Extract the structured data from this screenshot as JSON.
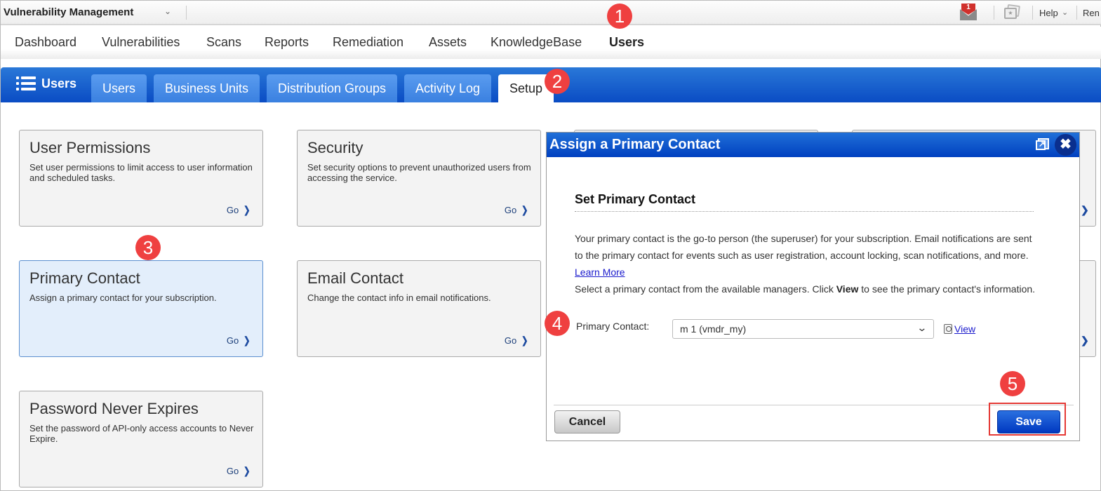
{
  "topbar": {
    "app_title": "Vulnerability Management",
    "notification_count": "1",
    "help_label": "Help",
    "truncated_right_label": "Ren"
  },
  "main_nav": {
    "items": [
      {
        "label": "Dashboard",
        "active": false
      },
      {
        "label": "Vulnerabilities",
        "active": false
      },
      {
        "label": "Scans",
        "active": false
      },
      {
        "label": "Reports",
        "active": false
      },
      {
        "label": "Remediation",
        "active": false
      },
      {
        "label": "Assets",
        "active": false
      },
      {
        "label": "KnowledgeBase",
        "active": false
      },
      {
        "label": "Users",
        "active": true
      }
    ]
  },
  "module": {
    "title": "Users",
    "tabs": [
      {
        "label": "Users",
        "active": false
      },
      {
        "label": "Business Units",
        "active": false
      },
      {
        "label": "Distribution Groups",
        "active": false
      },
      {
        "label": "Activity Log",
        "active": false
      },
      {
        "label": "Setup",
        "active": true
      }
    ]
  },
  "cards": [
    {
      "title": "User Permissions",
      "description": "Set user permissions to limit access to user information and scheduled tasks.",
      "go_label": "Go",
      "selected": false
    },
    {
      "title": "Security",
      "description": "Set security options to prevent unauthorized users from accessing the service.",
      "go_label": "Go",
      "selected": false
    },
    {
      "title": "Primary Contact",
      "description": "Assign a primary contact for your subscription.",
      "go_label": "Go",
      "selected": true
    },
    {
      "title": "Email Contact",
      "description": "Change the contact info in email notifications.",
      "go_label": "Go",
      "selected": false
    },
    {
      "title": "Password Never Expires",
      "description": "Set the password of API-only access accounts to Never Expire.",
      "go_label": "Go",
      "selected": false
    }
  ],
  "dialog": {
    "title": "Assign a Primary Contact",
    "subtitle": "Set Primary Contact",
    "paragraph1": "Your primary contact is the go-to person (the superuser) for your subscription. Email notifications are sent to the primary contact for events such as user registration, account locking, scan notifications, and more.",
    "learn_more_label": "Learn More",
    "paragraph2_before": "Select a primary contact from the available managers. Click ",
    "paragraph2_bold": "View",
    "paragraph2_after": " to see the primary contact's information.",
    "primary_contact_label": "Primary Contact:",
    "primary_contact_value": "m 1 (vmdr_my)",
    "view_label": "View",
    "cancel_label": "Cancel",
    "save_label": "Save"
  },
  "step_badges": [
    "1",
    "2",
    "3",
    "4",
    "5"
  ],
  "colors": {
    "brand_blue": "#0a4cc4",
    "step_badge": "#ef4040",
    "highlight": "#e53935",
    "selected_card": "#e3eefb",
    "link": "#1a1acc"
  }
}
